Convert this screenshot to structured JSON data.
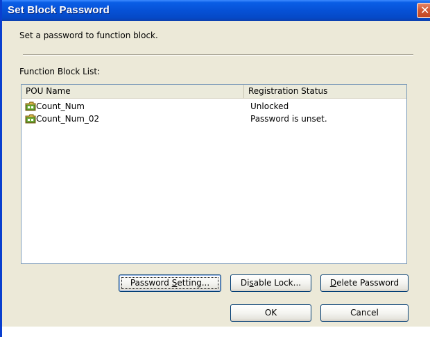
{
  "window": {
    "title": "Set Block Password",
    "close_glyph": "✕"
  },
  "description": "Set a password to function block.",
  "list_label": "Function Block List:",
  "list": {
    "columns": [
      "POU Name",
      "Registration Status"
    ],
    "rows": [
      {
        "icon": "function-block-folder-icon",
        "name": "Count_Num",
        "status": "Unlocked"
      },
      {
        "icon": "function-block-folder-icon",
        "name": "Count_Num_02",
        "status": "Password is unset."
      }
    ]
  },
  "buttons": {
    "password_setting": {
      "pre": "Password ",
      "mnemonic": "S",
      "post": "etting..."
    },
    "disable_lock": {
      "pre": "Di",
      "mnemonic": "s",
      "post": "able Lock..."
    },
    "delete_password": {
      "pre": "",
      "mnemonic": "D",
      "post": "elete Password"
    },
    "ok": "OK",
    "cancel": "Cancel"
  },
  "colors": {
    "titlebar": "#0651d6",
    "dialog_bg": "#ece9d8",
    "close_button": "#d35a35"
  }
}
